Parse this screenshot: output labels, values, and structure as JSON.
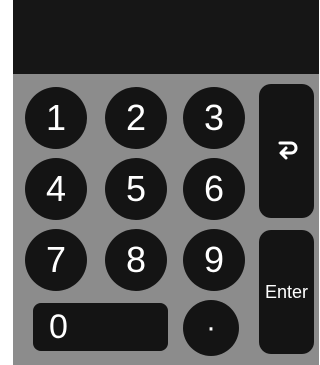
{
  "keypad": {
    "display_value": "",
    "keys": {
      "k1": "1",
      "k2": "2",
      "k3": "3",
      "k4": "4",
      "k5": "5",
      "k6": "6",
      "k7": "7",
      "k8": "8",
      "k9": "9",
      "k0": "0",
      "decimal": "·",
      "backspace": "↩",
      "enter": "Enter"
    },
    "colors": {
      "panel": "#8c8c8c",
      "display": "#161616",
      "key": "#141414",
      "key_text": "#ffffff"
    }
  }
}
